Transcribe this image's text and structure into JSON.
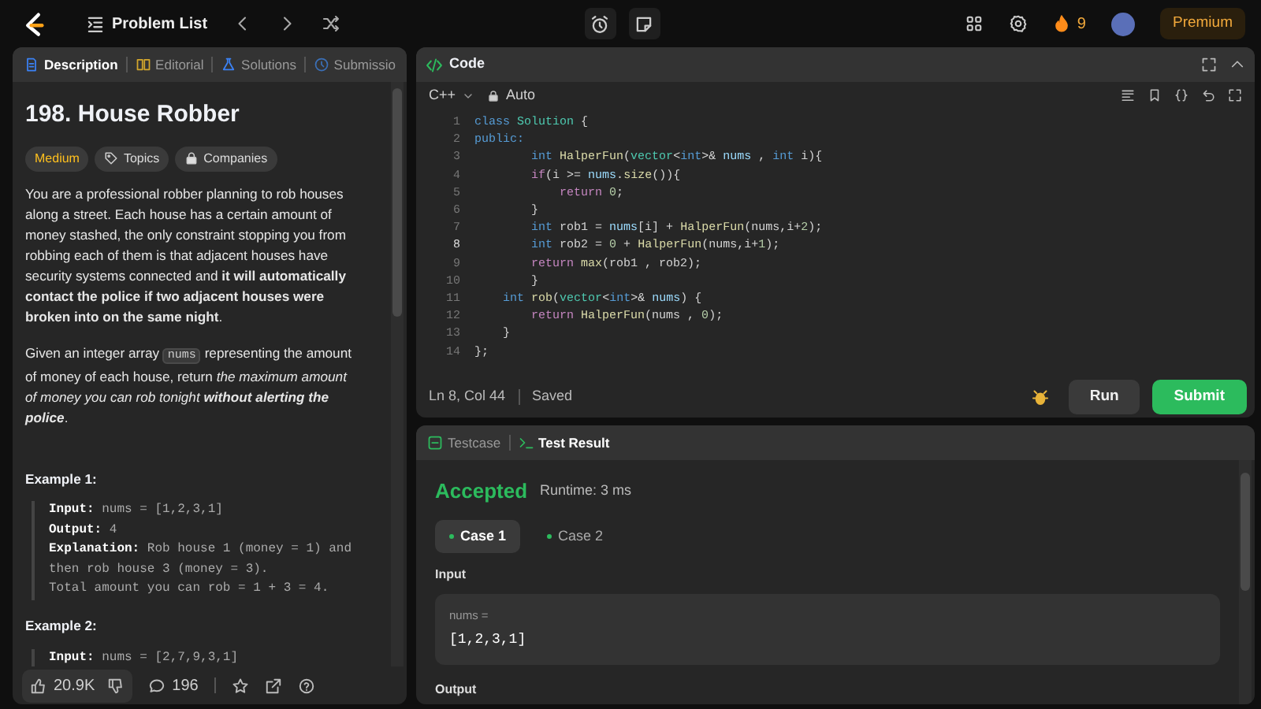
{
  "top_bar": {
    "problem_list": "Problem List",
    "streak": "9",
    "premium": "Premium"
  },
  "description_panel": {
    "tabs": [
      {
        "label": "Description",
        "selected": true,
        "kind": "description"
      },
      {
        "label": "Editorial",
        "selected": false,
        "kind": "editorial"
      },
      {
        "label": "Solutions",
        "selected": false,
        "kind": "solutions"
      },
      {
        "label": "Submissio",
        "selected": false,
        "kind": "submissions"
      }
    ],
    "title": "198. House Robber",
    "difficulty": "Medium",
    "tags": [
      {
        "label": "Topics",
        "kind": "tag"
      },
      {
        "label": "Companies",
        "kind": "lock"
      }
    ],
    "paragraphs": [
      {
        "segments": [
          {
            "kind": "text",
            "text": "You are a professional robber planning to rob houses along a street. Each house has a certain amount of money stashed, the only constraint stopping you from robbing each of them is that adjacent houses have security systems connected and **it will automatically contact the police if two adjacent houses were broken into on the same night**."
          }
        ]
      },
      {
        "segments": [
          {
            "kind": "text",
            "text": "Given an integer array "
          },
          {
            "kind": "code",
            "text": "nums"
          },
          {
            "kind": "text",
            "text": " representing the amount of money of each house, return "
          },
          {
            "kind": "emphasis",
            "text": "the maximum amount of money you can rob tonight **without alerting the police**"
          },
          {
            "kind": "text",
            "text": "."
          }
        ]
      }
    ],
    "examples": [
      {
        "heading": "Example 1:",
        "lines": [
          {
            "label": "Input:",
            "value": "nums = [1,2,3,1]"
          },
          {
            "label": "Output:",
            "value": "4"
          },
          {
            "label": "Explanation:",
            "value": "Rob house 1 (money = 1) and then rob house 3 (money = 3).\nTotal amount you can rob = 1 + 3 = 4."
          }
        ]
      },
      {
        "heading": "Example 2:",
        "lines": [
          {
            "label": "Input:",
            "value": "nums = [2,7,9,3,1]"
          }
        ]
      }
    ],
    "footer": {
      "likes": "20.9K",
      "comments": "196"
    }
  },
  "code_panel": {
    "title": "Code",
    "language": "C++",
    "mode": "Auto",
    "lines": [
      {
        "number": "1",
        "current": false,
        "tokens": [
          {
            "kind": "keyword",
            "text": "class "
          },
          {
            "kind": "type",
            "text": "Solution"
          },
          {
            "kind": "plain",
            "text": " {"
          }
        ]
      },
      {
        "number": "2",
        "current": false,
        "tokens": [
          {
            "kind": "keyword",
            "text": "public:"
          }
        ]
      },
      {
        "number": "3",
        "current": false,
        "tokens": [
          {
            "kind": "keyword",
            "text": "        int "
          },
          {
            "kind": "function",
            "text": "HalperFun"
          },
          {
            "kind": "plain",
            "text": "("
          },
          {
            "kind": "type",
            "text": "vector"
          },
          {
            "kind": "plain",
            "text": "<"
          },
          {
            "kind": "keyword",
            "text": "int"
          },
          {
            "kind": "plain",
            "text": ">& "
          },
          {
            "kind": "variable",
            "text": "nums"
          },
          {
            "kind": "plain",
            "text": " , "
          },
          {
            "kind": "keyword",
            "text": "int"
          },
          {
            "kind": "plain",
            "text": " i){"
          }
        ]
      },
      {
        "number": "4",
        "current": false,
        "tokens": [
          {
            "kind": "control",
            "text": "        if"
          },
          {
            "kind": "plain",
            "text": "(i >= "
          },
          {
            "kind": "variable",
            "text": "nums"
          },
          {
            "kind": "plain",
            "text": "."
          },
          {
            "kind": "function",
            "text": "size"
          },
          {
            "kind": "plain",
            "text": "()){"
          }
        ]
      },
      {
        "number": "5",
        "current": false,
        "tokens": [
          {
            "kind": "control",
            "text": "            return "
          },
          {
            "kind": "number",
            "text": "0"
          },
          {
            "kind": "plain",
            "text": ";"
          }
        ]
      },
      {
        "number": "6",
        "current": false,
        "tokens": [
          {
            "kind": "plain",
            "text": "        }"
          }
        ]
      },
      {
        "number": "7",
        "current": false,
        "tokens": [
          {
            "kind": "keyword",
            "text": "        int"
          },
          {
            "kind": "plain",
            "text": " rob1 = "
          },
          {
            "kind": "variable",
            "text": "nums"
          },
          {
            "kind": "plain",
            "text": "[i] + "
          },
          {
            "kind": "function",
            "text": "HalperFun"
          },
          {
            "kind": "plain",
            "text": "(nums,i+"
          },
          {
            "kind": "number",
            "text": "2"
          },
          {
            "kind": "plain",
            "text": ");"
          }
        ]
      },
      {
        "number": "8",
        "current": true,
        "tokens": [
          {
            "kind": "keyword",
            "text": "        int"
          },
          {
            "kind": "plain",
            "text": " rob2 = "
          },
          {
            "kind": "number",
            "text": "0"
          },
          {
            "kind": "plain",
            "text": " + "
          },
          {
            "kind": "function",
            "text": "HalperFun"
          },
          {
            "kind": "plain",
            "text": "(nums,i+"
          },
          {
            "kind": "number",
            "text": "1"
          },
          {
            "kind": "plain",
            "text": ");"
          }
        ]
      },
      {
        "number": "9",
        "current": false,
        "tokens": [
          {
            "kind": "control",
            "text": "        return "
          },
          {
            "kind": "function",
            "text": "max"
          },
          {
            "kind": "plain",
            "text": "(rob1 , rob2);"
          }
        ]
      },
      {
        "number": "10",
        "current": false,
        "tokens": [
          {
            "kind": "plain",
            "text": "        }"
          }
        ]
      },
      {
        "number": "11",
        "current": false,
        "tokens": [
          {
            "kind": "keyword",
            "text": "    int "
          },
          {
            "kind": "function",
            "text": "rob"
          },
          {
            "kind": "plain",
            "text": "("
          },
          {
            "kind": "type",
            "text": "vector"
          },
          {
            "kind": "plain",
            "text": "<"
          },
          {
            "kind": "keyword",
            "text": "int"
          },
          {
            "kind": "plain",
            "text": ">& "
          },
          {
            "kind": "variable",
            "text": "nums"
          },
          {
            "kind": "plain",
            "text": ") {"
          }
        ]
      },
      {
        "number": "12",
        "current": false,
        "tokens": [
          {
            "kind": "control",
            "text": "        return "
          },
          {
            "kind": "function",
            "text": "HalperFun"
          },
          {
            "kind": "plain",
            "text": "(nums , "
          },
          {
            "kind": "number",
            "text": "0"
          },
          {
            "kind": "plain",
            "text": ");"
          }
        ]
      },
      {
        "number": "13",
        "current": false,
        "tokens": [
          {
            "kind": "plain",
            "text": "    }"
          }
        ]
      },
      {
        "number": "14",
        "current": false,
        "tokens": [
          {
            "kind": "plain",
            "text": "};"
          }
        ]
      }
    ],
    "status": {
      "position": "Ln 8, Col 44",
      "saved": "Saved"
    },
    "buttons": {
      "run": "Run",
      "submit": "Submit"
    }
  },
  "result_panel": {
    "tabs": [
      {
        "label": "Testcase",
        "selected": false,
        "kind": "testcase"
      },
      {
        "label": "Test Result",
        "selected": true,
        "kind": "result"
      }
    ],
    "verdict": "Accepted",
    "runtime": "Runtime: 3 ms",
    "cases": [
      {
        "label": "Case 1",
        "selected": true
      },
      {
        "label": "Case 2",
        "selected": false
      }
    ],
    "input_label": "Input",
    "inputs": [
      {
        "name": "nums =",
        "value": "[1,2,3,1]"
      }
    ],
    "output_label": "Output"
  }
}
